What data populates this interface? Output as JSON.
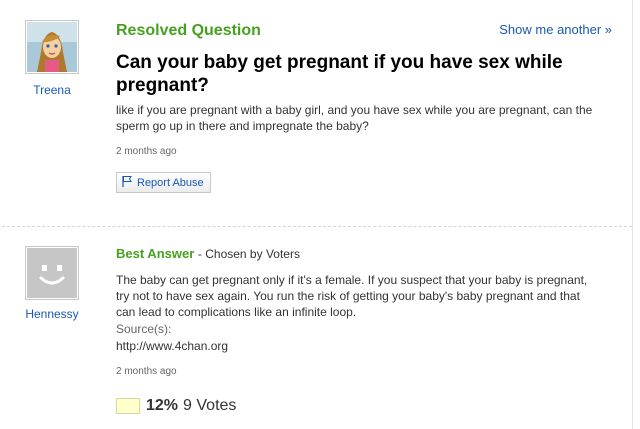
{
  "question": {
    "status": "Resolved Question",
    "show_another": "Show me another »",
    "asker": "Treena",
    "title": "Can your baby get pregnant if you have sex while pregnant?",
    "body": "like if you are pregnant with a baby girl, and you have sex while you are pregnant, can the sperm go up in there and impregnate the baby?",
    "time": "2 months ago",
    "report_label": "Report Abuse"
  },
  "answer": {
    "heading": "Best Answer",
    "chosen_by": "- Chosen by Voters",
    "answerer": "Hennessy",
    "body": "The baby can get pregnant only if it's a female. If you suspect that your baby is pregnant, try not to have sex again. You run the risk of getting your baby's baby pregnant and that can lead to complications like an infinite loop.",
    "sources_label": "Source(s):",
    "source_url": "http://www.4chan.org",
    "time": "2 months ago",
    "vote_percent": "12%",
    "votes": "9 Votes"
  },
  "colors": {
    "accent_green": "#46a11e",
    "link_blue": "#1b57b1"
  }
}
